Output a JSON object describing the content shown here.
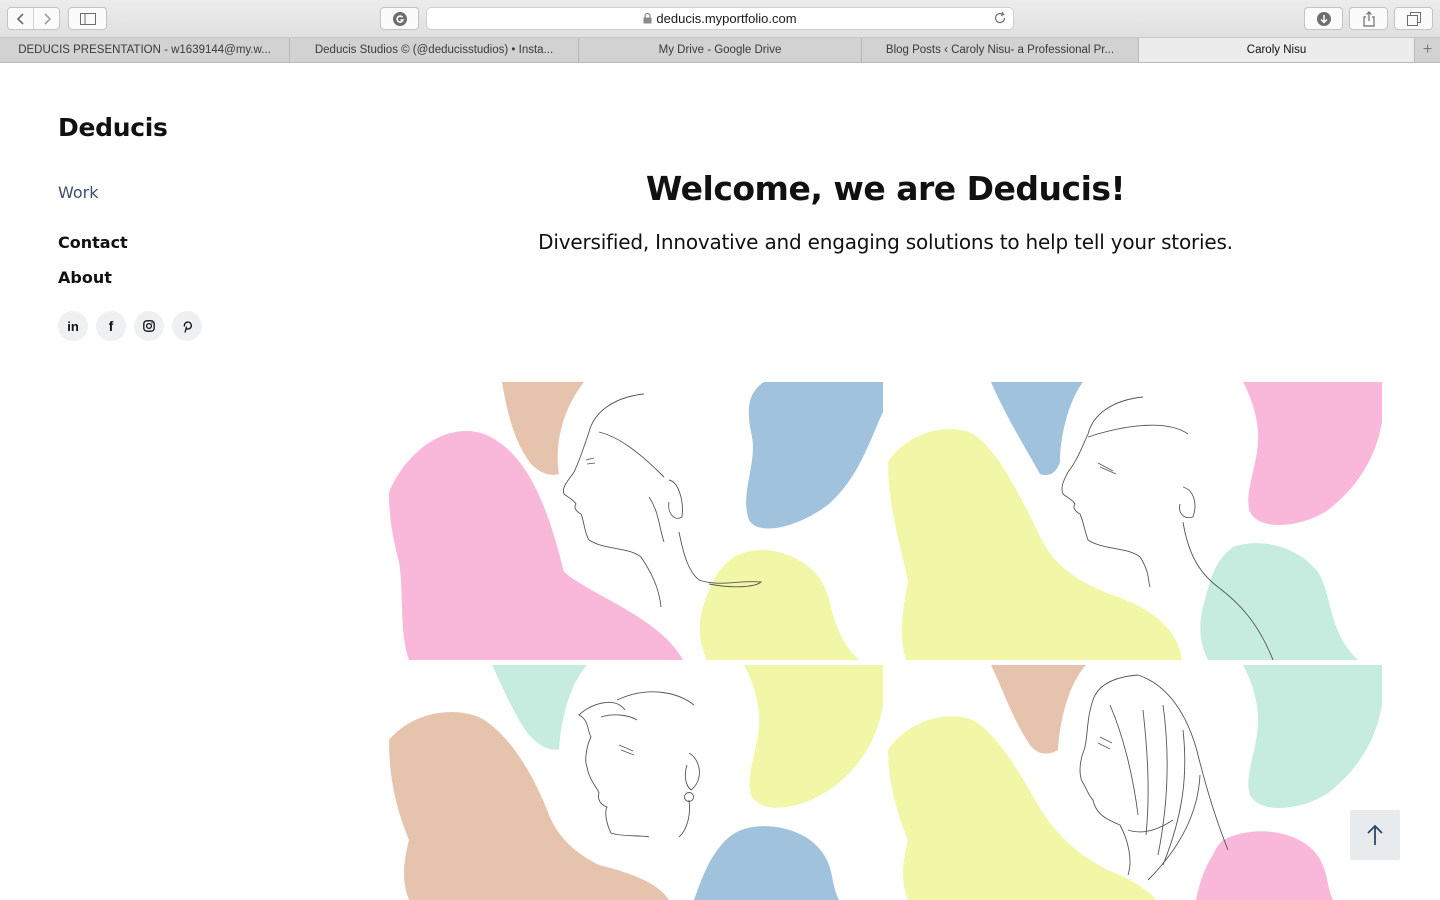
{
  "browser": {
    "url": "deducis.myportfolio.com",
    "tabs": [
      {
        "label": "DEDUCIS PRESENTATION - w1639144@my.w..."
      },
      {
        "label": "Deducis Studios © (@deducisstudios) • Insta..."
      },
      {
        "label": "My Drive - Google Drive"
      },
      {
        "label": "Blog Posts ‹ Caroly Nisu- a Professional Pr..."
      },
      {
        "label": "Caroly Nisu"
      }
    ],
    "active_tab": 4
  },
  "site": {
    "title": "Deducis",
    "nav": {
      "work": "Work",
      "contact": "Contact",
      "about": "About"
    },
    "social": [
      {
        "label": "in",
        "icon": "linkedin-icon"
      },
      {
        "label": "f",
        "icon": "facebook-icon"
      },
      {
        "label": "instagram",
        "icon": "instagram-icon"
      },
      {
        "label": "pinterest",
        "icon": "pinterest-icon"
      }
    ]
  },
  "hero": {
    "title": "Welcome, we are Deducis!",
    "subtitle": "Diversified, Innovative and engaging solutions to help tell your stories."
  },
  "gallery": {
    "palette": {
      "pink": "#f9b8d9",
      "tan": "#e6c3ad",
      "blue": "#a1c2dc",
      "yellow": "#f2f7a8",
      "mint": "#c6ebdf"
    },
    "items": [
      {
        "icon": "woman-profile-illustration",
        "bg": "pink"
      },
      {
        "icon": "woman-profile-illustration",
        "bg": "yellow"
      },
      {
        "icon": "man-profile-illustration",
        "bg": "tan"
      },
      {
        "icon": "hijab-profile-illustration",
        "bg": "yellow"
      }
    ]
  },
  "scroll_top_icon": "arrow-up-icon"
}
